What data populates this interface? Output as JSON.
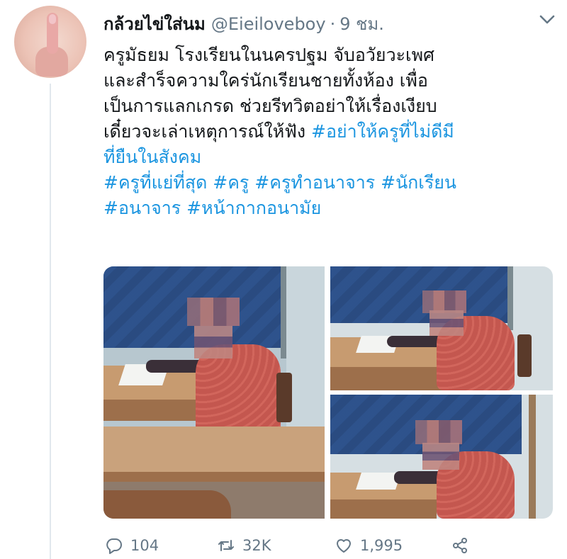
{
  "tweet": {
    "display_name": "กล้วยไข่ใส่นม",
    "handle": "@Eieiloveboy",
    "separator": "·",
    "time": "9 ชม.",
    "lines": [
      [
        {
          "text": "ครูมัธยม โรงเรียนในนครปฐม จับอวัยวะเพศ",
          "hashtag": false
        }
      ],
      [
        {
          "text": "และสำร็จความใคร่นักเรียนชายทั้งห้อง เพื่อ",
          "hashtag": false
        }
      ],
      [
        {
          "text": "เป็นการแลกเกรด ช่วยรีทวิตอย่าให้เรื่องเงียบ",
          "hashtag": false
        }
      ],
      [
        {
          "text": "เดี๋ยวจะเล่าเหตุการณ์ให้ฟัง ",
          "hashtag": false
        },
        {
          "text": "#อย่าให้ครูที่ไม่ดีมี",
          "hashtag": true
        }
      ],
      [
        {
          "text": "ที่ยืนในสังคม",
          "hashtag": true
        }
      ],
      [
        {
          "text": "#ครูที่แย่ที่สุด #ครู #ครูทำอนาจาร #นักเรียน",
          "hashtag": true
        }
      ],
      [
        {
          "text": "#อนาจาร #หน้ากากอนามัย",
          "hashtag": true
        }
      ]
    ]
  },
  "actions": {
    "reply_count": "104",
    "retweet_count": "32K",
    "like_count": "1,995"
  },
  "icons": {
    "more": "chevron-down-icon",
    "reply": "reply-icon",
    "retweet": "retweet-icon",
    "like": "heart-icon",
    "share": "share-icon"
  },
  "colors": {
    "text": "#14171a",
    "secondary": "#657786",
    "hashtag": "#1b95e0"
  }
}
